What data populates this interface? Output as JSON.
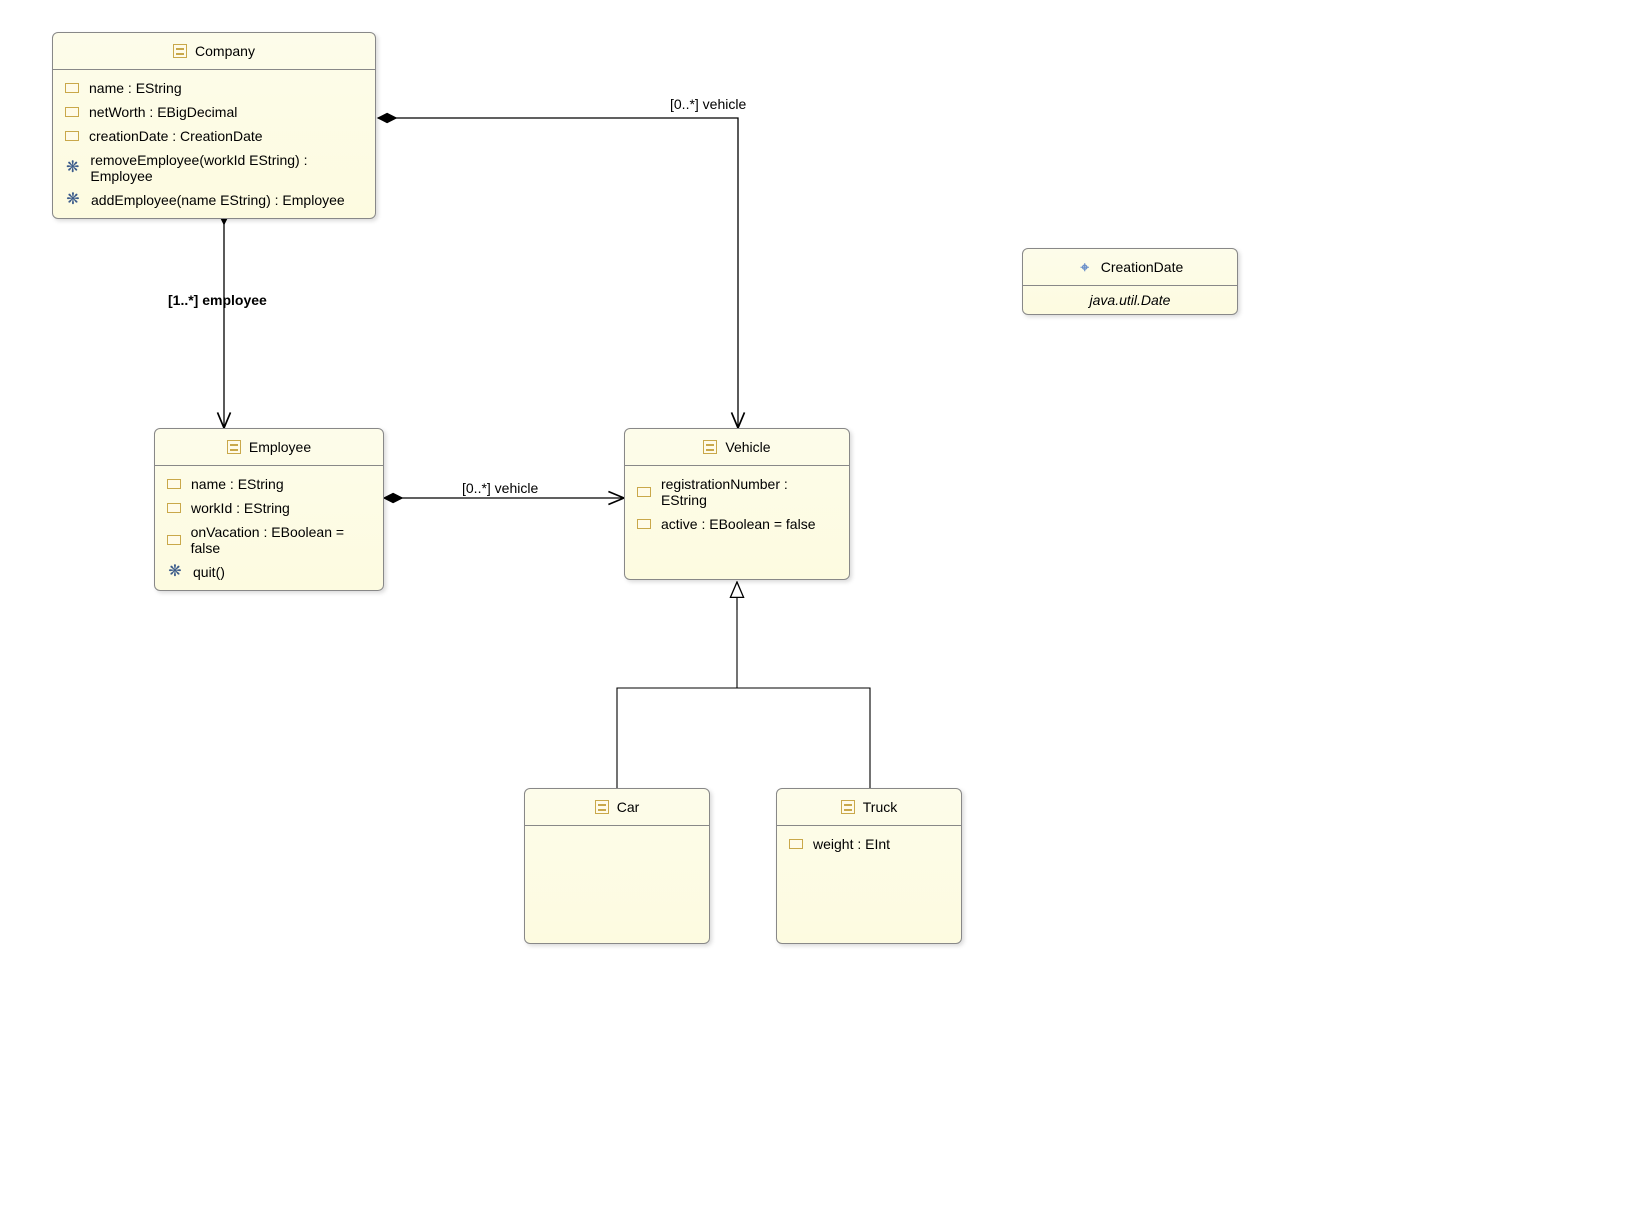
{
  "classes": {
    "company": {
      "name": "Company",
      "attrs": [
        {
          "text": "name : EString",
          "kind": "attr"
        },
        {
          "text": "netWorth : EBigDecimal",
          "kind": "attr"
        },
        {
          "text": "creationDate : CreationDate",
          "kind": "attr"
        },
        {
          "text": "removeEmployee(workId EString) : Employee",
          "kind": "op"
        },
        {
          "text": "addEmployee(name EString) : Employee",
          "kind": "op"
        }
      ]
    },
    "employee": {
      "name": "Employee",
      "attrs": [
        {
          "text": "name : EString",
          "kind": "attr"
        },
        {
          "text": "workId : EString",
          "kind": "attr"
        },
        {
          "text": "onVacation : EBoolean = false",
          "kind": "attr"
        },
        {
          "text": "quit()",
          "kind": "op"
        }
      ]
    },
    "vehicle": {
      "name": "Vehicle",
      "attrs": [
        {
          "text": "registrationNumber : EString",
          "kind": "attr"
        },
        {
          "text": "active : EBoolean = false",
          "kind": "attr"
        }
      ]
    },
    "car": {
      "name": "Car",
      "attrs": []
    },
    "truck": {
      "name": "Truck",
      "attrs": [
        {
          "text": "weight : EInt",
          "kind": "attr"
        }
      ]
    },
    "creationDate": {
      "name": "CreationDate",
      "instance": "java.util.Date"
    }
  },
  "associations": {
    "company_employee": "[1..*] employee",
    "company_vehicle": "[0..*] vehicle",
    "employee_vehicle": "[0..*] vehicle"
  },
  "diagram_meta": {
    "type": "UML Class Diagram (Ecore)",
    "relations": [
      {
        "from": "Company",
        "to": "Employee",
        "kind": "composition",
        "label": "[1..*] employee"
      },
      {
        "from": "Company",
        "to": "Vehicle",
        "kind": "composition",
        "label": "[0..*] vehicle"
      },
      {
        "from": "Employee",
        "to": "Vehicle",
        "kind": "composition",
        "label": "[0..*] vehicle"
      },
      {
        "from": "Car",
        "to": "Vehicle",
        "kind": "generalization"
      },
      {
        "from": "Truck",
        "to": "Vehicle",
        "kind": "generalization"
      }
    ]
  }
}
